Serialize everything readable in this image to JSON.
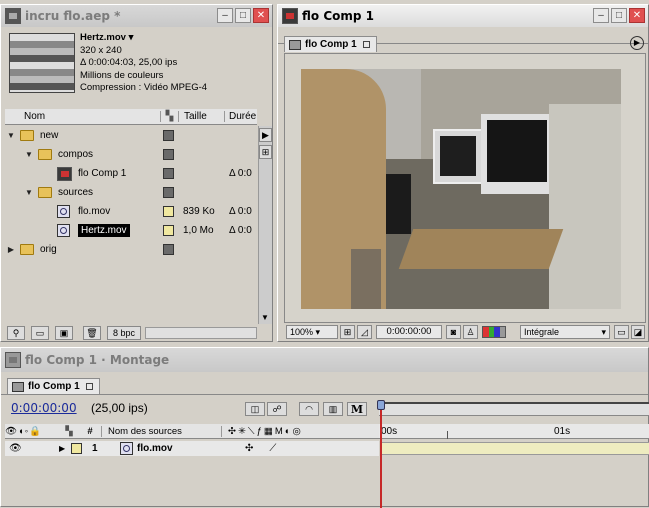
{
  "project": {
    "title": "incru flo.aep *",
    "footage": {
      "name": "Hertz.mov",
      "dimensions": "320 x 240",
      "duration": "Δ 0:00:04:03, 25,00 ips",
      "colors": "Millions de couleurs",
      "compression": "Compression : Vidéo MPEG-4"
    },
    "columns": {
      "name": "Nom",
      "size": "Taille",
      "duration": "Durée"
    },
    "items": [
      {
        "name": "new",
        "color": "#6a6a6a"
      },
      {
        "name": "compos",
        "color": "#6a6a6a"
      },
      {
        "name": "flo Comp 1",
        "color": "#6a6a6a",
        "duration": "Δ 0:0"
      },
      {
        "name": "sources",
        "color": "#6a6a6a"
      },
      {
        "name": "flo.mov",
        "color": "#f0e8a0",
        "size": "839 Ko",
        "duration": "Δ 0:0"
      },
      {
        "name": "Hertz.mov",
        "color": "#f0e8a0",
        "size": "1,0 Mo",
        "duration": "Δ 0:0"
      },
      {
        "name": "orig",
        "color": "#6a6a6a"
      }
    ],
    "bpc": "8 bpc"
  },
  "comp": {
    "title": "flo Comp 1",
    "tab": "flo Comp 1",
    "zoom": "100%",
    "timecode": "0:00:00:00",
    "resolution": "Intégrale"
  },
  "timeline": {
    "title": "flo Comp 1 · Montage",
    "tab": "flo Comp 1",
    "timecode": "0:00:00:00",
    "fps": "(25,00 ips)",
    "columns": {
      "num": "#",
      "source": "Nom des sources"
    },
    "ruler": {
      "start": "00s",
      "mark": "01s"
    },
    "layer": {
      "num": "1",
      "name": "flo.mov",
      "color": "#f0e8a0"
    },
    "m_label": "M"
  }
}
